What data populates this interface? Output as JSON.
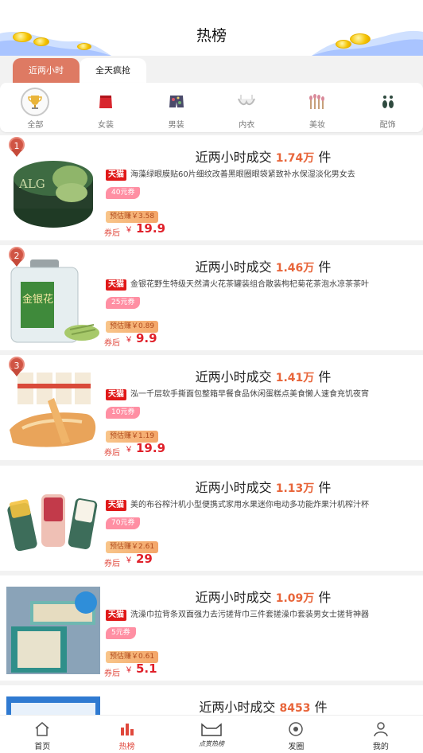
{
  "header": {
    "title": "热榜"
  },
  "tabs": [
    {
      "label": "近两小时",
      "active": true
    },
    {
      "label": "全天疯抢",
      "active": false
    }
  ],
  "categories": [
    {
      "label": "全部",
      "icon": "trophy-icon",
      "active": true
    },
    {
      "label": "女装",
      "icon": "red-dress-icon"
    },
    {
      "label": "男装",
      "icon": "shorts-icon"
    },
    {
      "label": "内衣",
      "icon": "bra-icon"
    },
    {
      "label": "美妆",
      "icon": "makeup-brush-icon"
    },
    {
      "label": "配饰",
      "icon": "earrings-icon"
    }
  ],
  "products": [
    {
      "rank": "1",
      "headline_prefix": "近两小时成交",
      "sales": "1.74万",
      "unit": "件",
      "mall_tag": "天猫",
      "title": "海藻绿眼膜贴60片细纹改善黑眼圈眼袋紧致补水保湿淡化男女去",
      "coupon": "40元券",
      "earn": "预估赚￥3.58",
      "after_label": "券后",
      "currency": "￥",
      "price": "19.9",
      "image": "green-eye-mask-jar"
    },
    {
      "rank": "2",
      "headline_prefix": "近两小时成交",
      "sales": "1.46万",
      "unit": "件",
      "mall_tag": "天猫",
      "title": "金银花野生特级天然清火花茶罐装组合散装枸杞菊花茶泡水凉茶茶叶",
      "coupon": "25元券",
      "earn": "预估赚￥0.89",
      "after_label": "券后",
      "currency": "￥",
      "price": "9.9",
      "image": "honeysuckle-tea-jar",
      "jar_label": "金银花"
    },
    {
      "rank": "3",
      "headline_prefix": "近两小时成交",
      "sales": "1.41万",
      "unit": "件",
      "mall_tag": "天猫",
      "title": "泓一千层软手撕面包整箱早餐食品休闲蛋糕点美食懒人速食充饥夜宵",
      "coupon": "10元券",
      "earn": "预估赚￥1.19",
      "after_label": "券后",
      "currency": "￥",
      "price": "19.9",
      "image": "layered-bread"
    },
    {
      "rank": "",
      "headline_prefix": "近两小时成交",
      "sales": "1.13万",
      "unit": "件",
      "mall_tag": "天猫",
      "title": "美的布谷榨汁机小型便携式家用水果迷你电动多功能炸果汁机榨汁杯",
      "coupon": "70元券",
      "earn": "预估赚￥2.61",
      "after_label": "券后",
      "currency": "￥",
      "price": "29",
      "image": "portable-juicers"
    },
    {
      "rank": "",
      "headline_prefix": "近两小时成交",
      "sales": "1.09万",
      "unit": "件",
      "mall_tag": "天猫",
      "title": "洗澡巾拉背条双面强力去污搓背巾三件套搓澡巾套装男女士搓背神器",
      "coupon": "5元券",
      "earn": "预估赚￥0.61",
      "after_label": "券后",
      "currency": "￥",
      "price": "5.1",
      "image": "bath-scrub-set"
    },
    {
      "rank": "",
      "headline_prefix": "近两小时成交",
      "sales": "8453",
      "unit": "件",
      "image": "blue-product-partial"
    }
  ],
  "bottom_nav": [
    {
      "label": "首页",
      "icon": "home-icon"
    },
    {
      "label": "热榜",
      "icon": "hot-chart-icon",
      "active": true
    },
    {
      "label": "点赏热榜",
      "icon": "cat-logo-icon"
    },
    {
      "label": "发圈",
      "icon": "camera-icon"
    },
    {
      "label": "我的",
      "icon": "user-icon"
    }
  ],
  "colors": {
    "accent": "#de7a63",
    "price_red": "#e0202a",
    "sales_orange": "#e8653a",
    "tmall_red": "#e01818",
    "coupon_pink": "#ff8fa3"
  }
}
